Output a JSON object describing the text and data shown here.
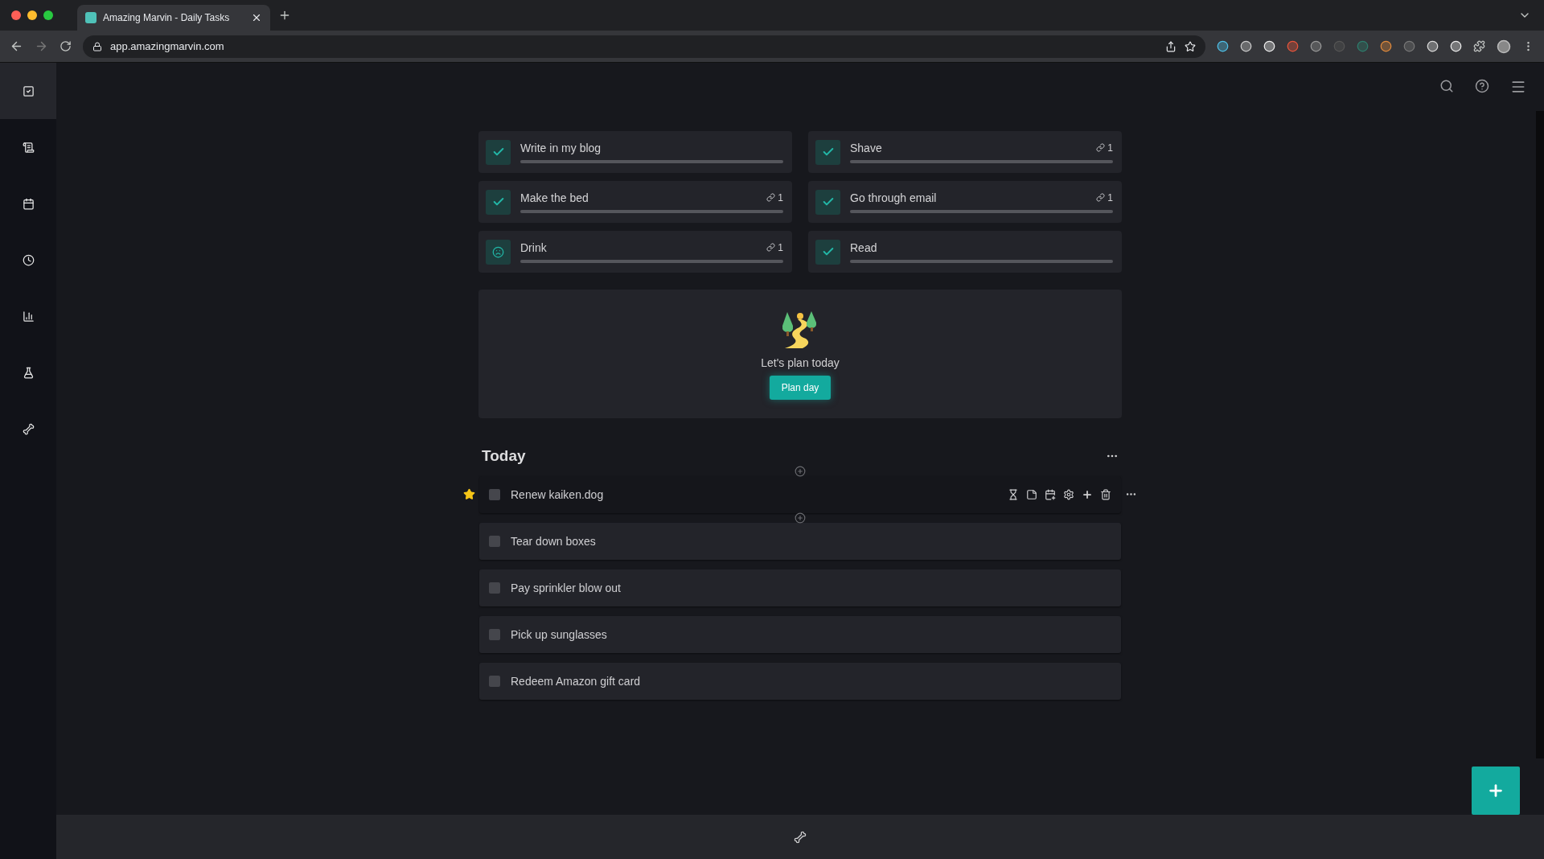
{
  "browser": {
    "tab_title": "Amazing Marvin - Daily Tasks",
    "url": "app.amazingmarvin.com"
  },
  "sidebar": {
    "items": [
      {
        "kind": "tasks",
        "selected": true
      },
      {
        "kind": "notes",
        "selected": false
      },
      {
        "kind": "calendar",
        "selected": false
      },
      {
        "kind": "clock",
        "selected": false
      },
      {
        "kind": "stats",
        "selected": false
      },
      {
        "kind": "lab",
        "selected": false
      },
      {
        "kind": "bone",
        "selected": false
      }
    ]
  },
  "habits": [
    {
      "name": "Write in my blog",
      "kind": "done",
      "level": 1
    },
    {
      "name": "Shave",
      "kind": "done",
      "count": "1",
      "level": 1
    },
    {
      "name": "Make the bed",
      "kind": "done",
      "count": "1",
      "level": 1
    },
    {
      "name": "Go through email",
      "kind": "done",
      "count": "1",
      "level": 1
    },
    {
      "name": "Drink",
      "kind": "missed",
      "count": "1",
      "level": 1
    },
    {
      "name": "Read",
      "kind": "done",
      "level": 1
    }
  ],
  "plan": {
    "message": "Let's plan today",
    "button": "Plan day"
  },
  "today": {
    "title": "Today",
    "tasks": [
      {
        "name": "Renew kaiken.dog",
        "starred": true,
        "checked": false,
        "selected": true
      },
      {
        "name": "Tear down boxes",
        "starred": false,
        "checked": false,
        "selected": false
      },
      {
        "name": "Pay sprinkler blow out",
        "starred": false,
        "checked": false,
        "selected": false
      },
      {
        "name": "Pick up sunglasses",
        "starred": false,
        "checked": false,
        "selected": false
      },
      {
        "name": "Redeem Amazon gift card",
        "starred": false,
        "checked": false,
        "selected": false
      }
    ]
  }
}
